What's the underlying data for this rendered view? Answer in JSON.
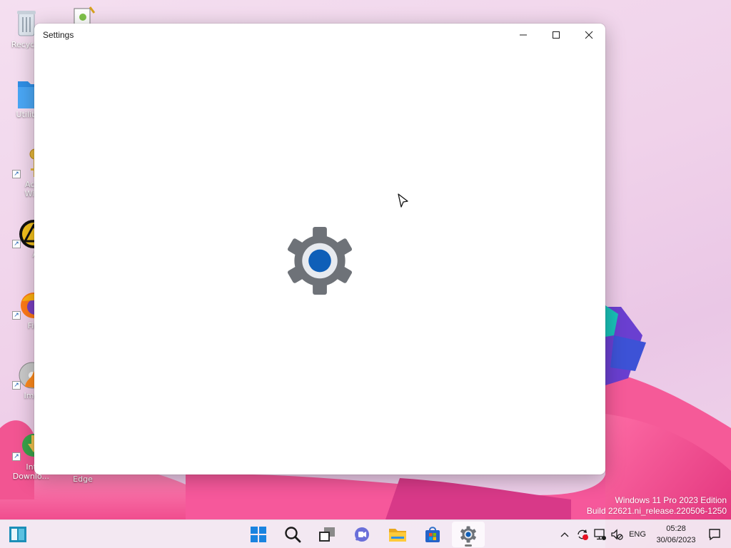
{
  "window": {
    "title": "Settings",
    "minimize_icon": "minimize-icon",
    "maximize_icon": "maximize-icon",
    "close_icon": "close-icon"
  },
  "desktop": {
    "icons": [
      {
        "label": "Recycle",
        "icon": "recycle-bin-icon"
      },
      {
        "label": "Utiliti",
        "icon": "folder-icon"
      },
      {
        "label": "Activa Windo",
        "icon": "key-icon"
      },
      {
        "label": "AIMI",
        "icon": "aimp-icon"
      },
      {
        "label": "Firefo",
        "icon": "firefox-icon"
      },
      {
        "label": "ImgBu",
        "icon": "imgburn-icon"
      },
      {
        "label": "Intern Downlo...",
        "icon": "idm-icon"
      },
      {
        "label": "Edge",
        "icon": "edge-icon"
      }
    ]
  },
  "watermark": {
    "line1": "Windows 11 Pro 2023 Edition",
    "line2": "Build 22621.ni_release.220506-1250"
  },
  "taskbar": {
    "items": [
      "widgets-icon",
      "start-icon",
      "search-icon",
      "task-view-icon",
      "teams-chat-icon",
      "file-explorer-icon",
      "store-icon",
      "settings-icon"
    ],
    "active_item": "settings-icon",
    "tray": {
      "language": "ENG",
      "time": "05:28",
      "date": "30/06/2023"
    }
  },
  "colors": {
    "accent": "#0f5fb8",
    "gear_gray": "#6e7278"
  }
}
